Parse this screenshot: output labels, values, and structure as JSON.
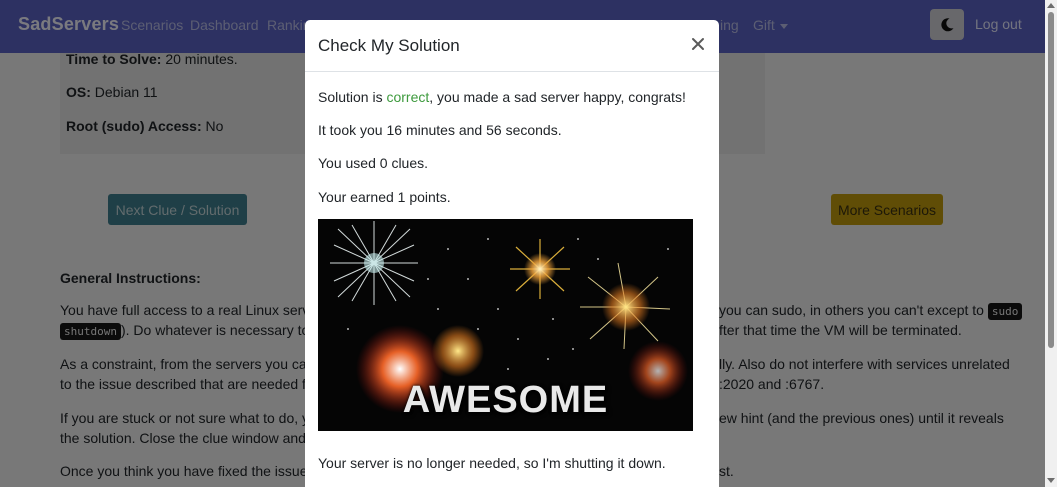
{
  "navbar": {
    "brand": "SadServers",
    "links": [
      "Scenarios",
      "Dashboard",
      "Rankin",
      "ing",
      "Gift"
    ],
    "logout": "Log out"
  },
  "info": {
    "time_label": "Time to Solve:",
    "time_value": "20 minutes.",
    "os_label": "OS:",
    "os_value": "Debian 11",
    "root_label": "Root (sudo) Access:",
    "root_value": "No"
  },
  "buttons": {
    "clue": "Next Clue / Solution",
    "more": "More Scenarios"
  },
  "instructions": {
    "title": "General Instructions:",
    "p1_left": "You have full access to a real Linux server",
    "p1_right_pre": "you can sudo, in others you can't except to ",
    "p1_code1": "sudo",
    "p1_code2": "shutdown",
    "p1_line2_left": "). Do whatever is necessary to fix",
    "p1_line2_right": "fter that time the VM will be terminated.",
    "p2_left": "As a constraint, from the servers you cann",
    "p2_right": "lly. Also do not interfere with services unrelated",
    "p2_line2_left": "to the issue described that are needed for",
    "p2_line2_right": ":2020 and :6767.",
    "p3_left": "If you are stuck or not sure what to do, yo",
    "p3_right": "ew hint (and the previous ones) until it reveals",
    "p3_line2_left": "the solution. Close the clue window and c",
    "p4_left": "Once you think you have fixed the issue, c",
    "p4_right": "st."
  },
  "modal": {
    "title": "Check My Solution",
    "close": "×",
    "line1_pre": "Solution is ",
    "line1_correct": "correct",
    "line1_post": ", you made a sad server happy, congrats!",
    "line2": "It took you 16 minutes and 56 seconds.",
    "line3": "You used 0 clues.",
    "line4": "Your earned 1 points.",
    "gif_text": "AWESOME",
    "line5": "Your server is no longer needed, so I'm shutting it down."
  },
  "colors": {
    "navbar": "#5b63c4",
    "correct": "#3d9a3d",
    "clue_button": "#3f7f8e",
    "more_button": "#c19b0c"
  }
}
